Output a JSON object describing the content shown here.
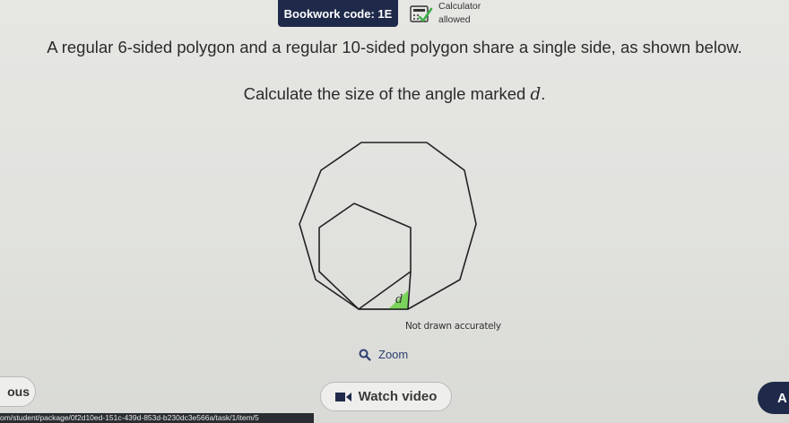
{
  "header": {
    "bookwork": "Bookwork code: 1E",
    "calculator_line1": "Calculator",
    "calculator_line2": "allowed"
  },
  "question": {
    "line1": "A regular 6-sided polygon and a regular 10-sided polygon share a single side, as shown below.",
    "line2_prefix": "Calculate the size of the angle marked ",
    "line2_var": "d",
    "line2_suffix": "."
  },
  "figure": {
    "angle_label": "d",
    "note": "Not drawn accurately",
    "highlight_color": "#7ad35a"
  },
  "controls": {
    "zoom_label": "Zoom",
    "previous_label": "ous",
    "watch_video_label": "Watch video",
    "next_label": "A"
  },
  "status": {
    "url": "om/student/package/0f2d10ed-151c-439d-853d-b230dc3e566a/task/1/item/5"
  }
}
